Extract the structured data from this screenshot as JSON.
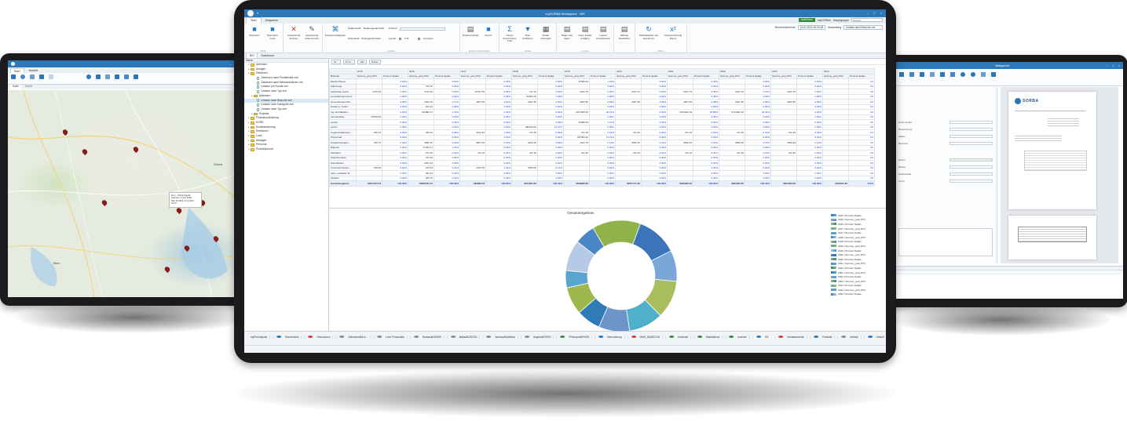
{
  "center": {
    "window_title": "myDORBA Workspace · BIS",
    "tabs": [
      "Start",
      "Diagramm"
    ],
    "topright": {
      "status": "ausführen",
      "user": "myDORBA",
      "group_label": "Hauptgruppe",
      "search_placeholder": "Suchen...",
      "date_label": "Neu berechnet am",
      "date_value": "16.01.2024 00:30:28",
      "eval_label": "Auswertung",
      "eval_value": "Umsatz nach Branche.xml"
    },
    "ribbon": {
      "groups": [
        {
          "name": "Datei",
          "buttons": [
            "Speichern",
            "Speichern unter"
          ]
        },
        {
          "name": "",
          "buttons": [
            "Auswertung löschen",
            "Auswertung umbenennen"
          ]
        },
        {
          "name": "Ansicht",
          "buttons": [
            "Zusammenklappen"
          ],
          "options": [
            "Spaltentotal",
            "Spaltengesamttotal",
            "Zeilentotal",
            "Zeilengesamttotal"
          ],
          "prozent_label": "Prozent",
          "layout_label": "Layout",
          "layout_full": "Full",
          "layout_compact": "Compact"
        },
        {
          "name": "Export und Drucken",
          "buttons": [
            "Druckvorschau",
            "Export"
          ]
        },
        {
          "name": "Felder",
          "buttons": [
            "Neues berechnetes Feld",
            "Filter aufheben",
            "Felder verbergen"
          ]
        },
        {
          "name": "Layout",
          "buttons": [
            "Daten neu laden",
            "Neue Felder anfügen",
            "Layout zurücksetzen"
          ]
        },
        {
          "name": "",
          "buttons": [
            "Abfrage bearbeiten"
          ]
        },
        {
          "name": "Daten",
          "buttons": [
            "Statistikdaten neu berechnen",
            "Kostenrechnung Bsp.4"
          ]
        }
      ]
    },
    "doc_tabs": [
      "BIS",
      "Dashboard"
    ],
    "tree": {
      "header": "Name",
      "nodes": [
        {
          "label": "Adressen",
          "type": "folder",
          "indent": 1
        },
        {
          "label": "Anlagen",
          "type": "folder",
          "indent": 1
        },
        {
          "label": "Debitoren",
          "type": "folder",
          "indent": 1
        },
        {
          "label": "Zahltoren nach Postleitzahl.xml",
          "type": "doc",
          "indent": 3
        },
        {
          "label": "Zahltoren nach Mehrwertsteuer.xml",
          "type": "doc",
          "indent": 3
        },
        {
          "label": "Umsatz pro Kunde.xml",
          "type": "doc",
          "indent": 3
        },
        {
          "label": "Umsatz nach Typ.xml",
          "type": "doc",
          "indent": 3
        },
        {
          "label": "Adressen",
          "type": "folder",
          "indent": 2
        },
        {
          "label": "Umsatz nach Branche.xml",
          "type": "doc",
          "indent": 3
        },
        {
          "label": "Umsatz nach Kategorie.xml",
          "type": "doc",
          "indent": 3
        },
        {
          "label": "Umsatz nach Typ.xml",
          "type": "doc",
          "indent": 3
        },
        {
          "label": "Projekte",
          "type": "folder",
          "indent": 2
        },
        {
          "label": "Finanzbuchhaltung",
          "type": "folder",
          "indent": 1
        },
        {
          "label": "KORE",
          "type": "folder",
          "indent": 1
        },
        {
          "label": "Kostenrechnung",
          "type": "folder",
          "indent": 1
        },
        {
          "label": "Kreditoren",
          "type": "folder",
          "indent": 1
        },
        {
          "label": "Lohn",
          "type": "folder",
          "indent": 1
        },
        {
          "label": "Manager",
          "type": "folder",
          "indent": 1
        },
        {
          "label": "Personal",
          "type": "folder",
          "indent": 1
        },
        {
          "label": "Produktjournal",
          "type": "folder",
          "indent": 1
        }
      ]
    },
    "pivot": {
      "filter_buttons": [
        "Gr...",
        "Ar ke...",
        "Jahr",
        "Datum"
      ],
      "row_header": "Branche",
      "years": [
        "2015",
        "2016",
        "2017",
        "2018",
        "2019",
        "2020",
        "2021",
        "2022",
        "2023",
        "2024"
      ],
      "col_sum": "Summe_yeld_PKV",
      "col_pct": "Prozent Spalte",
      "rows": [
        {
          "label": "Elektro-Planer",
          "cells": [
            "",
            "0.00%",
            "",
            "0.00%",
            "",
            "0.00%",
            "",
            "0.00%",
            "37600.00",
            "1.29%",
            "",
            "0.00%",
            "",
            "0.00%",
            "",
            "0.00%",
            "",
            "0.00%",
            "",
            "0.0"
          ]
        },
        {
          "label": "Fahrzeuge",
          "cells": [
            "",
            "0.00%",
            "372.25",
            "0.00%",
            "",
            "0.00%",
            "",
            "0.00%",
            "",
            "0.00%",
            "",
            "0.00%",
            "",
            "0.00%",
            "",
            "0.00%",
            "",
            "0.00%",
            "",
            "0.0"
          ]
        },
        {
          "label": "Gartenbau Garte...",
          "cells": [
            "1726.30",
            "0.00%",
            "1722.00",
            "0.00%",
            "10797.55",
            "0.00%",
            "712.75",
            "0.02%",
            "2321.75",
            "0.00%",
            "2321.75",
            "0.00%",
            "2321.75",
            "0.00%",
            "2321.75",
            "0.07%",
            "2321.75",
            "0.00%",
            "",
            "0.0"
          ]
        },
        {
          "label": "Generalunternehmer",
          "cells": [
            "",
            "0.00%",
            "",
            "0.00%",
            "",
            "0.00%",
            "50094.00",
            "1.35%",
            "",
            "0.00%",
            "",
            "0.00%",
            "",
            "0.00%",
            "",
            "0.00%",
            "",
            "0.00%",
            "",
            "0.0"
          ]
        },
        {
          "label": "Generalunternehm...",
          "cells": [
            "",
            "0.00%",
            "2362.00",
            "0.17%",
            "2967.80",
            "1.51%",
            "2967.80",
            "0.00%",
            "2967.80",
            "0.08%",
            "2967.80",
            "0.08%",
            "2967.80",
            "0.08%",
            "2967.80",
            "0.08%",
            "2967.80",
            "0.08%",
            "",
            "0.0"
          ]
        },
        {
          "label": "Handel u. Trabot",
          "cells": [
            "",
            "0.00%",
            "224.10",
            "0.02%",
            "",
            "0.00%",
            "",
            "0.00%",
            "",
            "0.00%",
            "",
            "0.00%",
            "",
            "0.00%",
            "",
            "0.00%",
            "",
            "0.00%",
            "",
            "0.0"
          ]
        },
        {
          "label": "Ing.-HLK/Elektro...",
          "cells": [
            "",
            "0.00%",
            "241882.27",
            "1.78%",
            "",
            "0.00%",
            "",
            "0.00%",
            "2327680.00",
            "25.16%",
            "",
            "0.00%",
            "2363022.39",
            "63.86%",
            "2744391.30",
            "33.03%",
            "",
            "0.00%",
            "",
            "0.0"
          ]
        },
        {
          "label": "Innenausbau",
          "cells": [
            "20516.60",
            "0.02%",
            "",
            "0.00%",
            "",
            "0.00%",
            "",
            "0.00%",
            "",
            "0.00%",
            "",
            "0.00%",
            "",
            "0.00%",
            "",
            "0.00%",
            "",
            "0.00%",
            "",
            "0.0"
          ]
        },
        {
          "label": "Landw.",
          "cells": [
            "",
            "0.00%",
            "",
            "0.00%",
            "",
            "0.00%",
            "",
            "0.00%",
            "16980.00",
            "1.27%",
            "",
            "0.00%",
            "",
            "0.00%",
            "",
            "0.00%",
            "",
            "0.00%",
            "",
            "0.0"
          ]
        },
        {
          "label": "Lehrer",
          "cells": [
            "",
            "0.00%",
            "",
            "0.00%",
            "",
            "0.00%",
            "480163.00",
            "12.47%",
            "",
            "0.00%",
            "",
            "0.00%",
            "",
            "0.00%",
            "",
            "0.00%",
            "",
            "0.00%",
            "",
            "0.0"
          ]
        },
        {
          "label": "Liegenschaftsverm...",
          "cells": [
            "236.75",
            "0.00%",
            "646.32",
            "0.05%",
            "2512.50",
            "1.40%",
            "711.25",
            "0.00%",
            "471.25",
            "0.02%",
            "471.25",
            "0.02%",
            "471.25",
            "0.02%",
            "471.25",
            "0.01%",
            "471.25",
            "0.00%",
            "",
            "0.0"
          ]
        },
        {
          "label": "Physiotrad",
          "cells": [
            "",
            "0.00%",
            "",
            "0.00%",
            "",
            "0.00%",
            "",
            "0.00%",
            "437564.90",
            "14.31%",
            "",
            "0.00%",
            "",
            "0.00%",
            "",
            "0.00%",
            "",
            "0.00%",
            "",
            "0.0"
          ]
        },
        {
          "label": "Projektmanagem...",
          "cells": [
            "330.75",
            "0.02%",
            "3580.22",
            "0.23%",
            "3507.00",
            "3.07%",
            "3916.25",
            "0.02%",
            "4312.75",
            "0.12%",
            "3536.25",
            "0.12%",
            "3536.25",
            "0.10%",
            "3536.25",
            "0.07%",
            "3536.25",
            "0.10%",
            "",
            "0.0"
          ]
        },
        {
          "label": "Rilgenet",
          "cells": [
            "",
            "0.00%",
            "37250.71",
            "1.76%",
            "",
            "0.00%",
            "",
            "0.00%",
            "",
            "0.00%",
            "",
            "0.00%",
            "",
            "0.00%",
            "",
            "0.00%",
            "",
            "0.00%",
            "",
            "0.0"
          ]
        },
        {
          "label": "Sanitären",
          "cells": [
            "",
            "0.00%",
            "577.30",
            "0.03%",
            "411.30",
            "0.22%",
            "411.30",
            "0.00%",
            "411.30",
            "0.01%",
            "411.30",
            "0.01%",
            "411.30",
            "0.01%",
            "411.30",
            "0.01%",
            "411.30",
            "0.01%",
            "",
            "0.0"
          ]
        },
        {
          "label": "Shell Produkte",
          "cells": [
            "",
            "0.00%",
            "674.30",
            "0.05%",
            "",
            "0.00%",
            "",
            "0.00%",
            "",
            "0.00%",
            "",
            "0.00%",
            "",
            "0.00%",
            "",
            "0.00%",
            "",
            "0.00%",
            "",
            "0.0"
          ]
        },
        {
          "label": "Steindrucker",
          "cells": [
            "",
            "0.00%",
            "2361.10",
            "0.18%",
            "",
            "0.00%",
            "",
            "0.00%",
            "",
            "0.00%",
            "",
            "0.00%",
            "",
            "0.00%",
            "",
            "0.00%",
            "",
            "0.00%",
            "",
            "0.0"
          ]
        },
        {
          "label": "Unternehmensbe...",
          "cells": [
            "705.00",
            "0.02%",
            "676.33",
            "0.04%",
            "2347.50",
            "1.32%",
            "3533.60",
            "0.12%",
            "",
            "0.00%",
            "",
            "0.00%",
            "",
            "0.00%",
            "",
            "0.00%",
            "",
            "0.00%",
            "",
            "0.0"
          ]
        },
        {
          "label": "Verm.-Leitfaden B...",
          "cells": [
            "",
            "0.00%",
            "264.10",
            "0.02%",
            "",
            "0.00%",
            "",
            "0.00%",
            "",
            "0.00%",
            "",
            "0.00%",
            "",
            "0.00%",
            "",
            "0.00%",
            "",
            "0.00%",
            "",
            "0.0"
          ]
        },
        {
          "label": "Ziegelei",
          "cells": [
            "",
            "0.00%",
            "405.70",
            "0.03%",
            "",
            "0.00%",
            "",
            "0.00%",
            "",
            "0.00%",
            "",
            "0.00%",
            "",
            "0.00%",
            "",
            "0.00%",
            "",
            "0.00%",
            "",
            "0.0"
          ]
        }
      ],
      "total": {
        "label": "Gesamtergebnis",
        "cells": [
          "2320*324.13",
          "100.00%",
          "13687221.21",
          "100.00%",
          "189283.33",
          "100.00%",
          "3914554.09",
          "100.00%",
          "3058965.65",
          "100.00%",
          "3565*177.65",
          "100.00%",
          "3569990.30",
          "100.00%",
          "3697327.65",
          "100.00%",
          "3697206.00",
          "100.00%",
          "3723914.63",
          "100.0"
        ]
      }
    },
    "chart": {
      "title": "Gesamtergebnis",
      "legend": [
        "2015 | Prozent Spalte",
        "2016 | Summe_yeld_PKV",
        "2016 | Prozent Spalte",
        "2017 | Summe_yeld_PKV",
        "2017 | Prozent Spalte",
        "2018 | Summe_yeld_PKV",
        "2018 | Prozent Spalte",
        "2019 | Summe_yeld_PKV",
        "2019 | Prozent Spalte",
        "2020 | Summe_yeld_PKV",
        "2020 | Prozent Spalte",
        "2021 | Summe_yeld_PKV",
        "2021 | Prozent Spalte",
        "2022 | Summe_yeld_PKV",
        "2022 | Prozent Spalte",
        "2023 | Summe_yeld_PKV",
        "2023 | Prozent Spalte",
        "2024 | Summe_yeld_PKV",
        "2024 | Prozent Spalte"
      ],
      "slice_colors": [
        "#3b74b8",
        "#7aa7d8",
        "#aabd5c",
        "#4fb0cc",
        "#6f95c8",
        "#2f7bb6",
        "#9fb84e",
        "#5aa4d0",
        "#b6c9e6",
        "#4a86c5",
        "#8fb24a",
        "#3e8fbf",
        "#2d6fb0"
      ],
      "slice_values": [
        12,
        9,
        11,
        10,
        9,
        7,
        8,
        5,
        9,
        6,
        14
      ]
    },
    "status_items": [
      {
        "label": "myProduktjunk",
        "color": ""
      },
      {
        "label": "Monitorkreis",
        "color": "#2b77b7"
      },
      {
        "label": "Ressourcen",
        "color": "#d63b3b"
      },
      {
        "label": "Adressmell&Inv...",
        "color": "#8a8a8a"
      },
      {
        "label": "Lohn Personalbs",
        "color": "#8a8a8a"
      },
      {
        "label": "BorsasiaDRGBS",
        "color": "#8a8a8a"
      },
      {
        "label": "ladkasDUSZON",
        "color": "#8a8a8a"
      },
      {
        "label": "AdressatSoltelAra",
        "color": "#8a8a8a"
      },
      {
        "label": "AbgesoltDRGDi",
        "color": "#8a8a8a"
      },
      {
        "label": "PRanzprallDRGDi",
        "color": "#2e8b3d"
      },
      {
        "label": "Memotchung",
        "color": "#2b77b7"
      },
      {
        "label": "MWZ_MADEZON",
        "color": "#d63b3b"
      },
      {
        "label": "Unterhalt",
        "color": "#2e8b3d"
      },
      {
        "label": "Materialruck",
        "color": "#2e8b3d"
      },
      {
        "label": "Inventur",
        "color": "#2e8b3d"
      },
      {
        "label": "BIS",
        "color": "#2b77b7"
      },
      {
        "label": "Vorratskontrolle",
        "color": "#d63b3b"
      },
      {
        "label": "Putzsafe",
        "color": "#2b77b7"
      },
      {
        "label": "Activity",
        "color": "#8a8a8a"
      },
      {
        "label": "Default",
        "color": "#2b77b7"
      }
    ]
  },
  "left": {
    "tabs": [
      "Start",
      "Ansicht"
    ],
    "map_tabs": [
      "Karte",
      "Satellit"
    ],
    "ribbon_buttons": [
      "Kartengrundlage",
      "Entfernungsmessung",
      "Standort",
      "Ortssuche",
      "Route"
    ],
    "popup_lines": [
      "ZH n - Präsenzgerät",
      "Lieferant: 4 (Art: ENZ)",
      "Dat: 08.2023, 13.4.2021 01:03"
    ],
    "places": [
      "Zürich",
      "Bern"
    ]
  },
  "right": {
    "title": "Belegarchiv",
    "brand": "SORBA",
    "form_labels": [
      "Dokumentart",
      "Bezeichnung",
      "Status",
      "Benutzer",
      "Datum",
      "Betrag",
      "Kostenstelle",
      "Konto"
    ]
  }
}
